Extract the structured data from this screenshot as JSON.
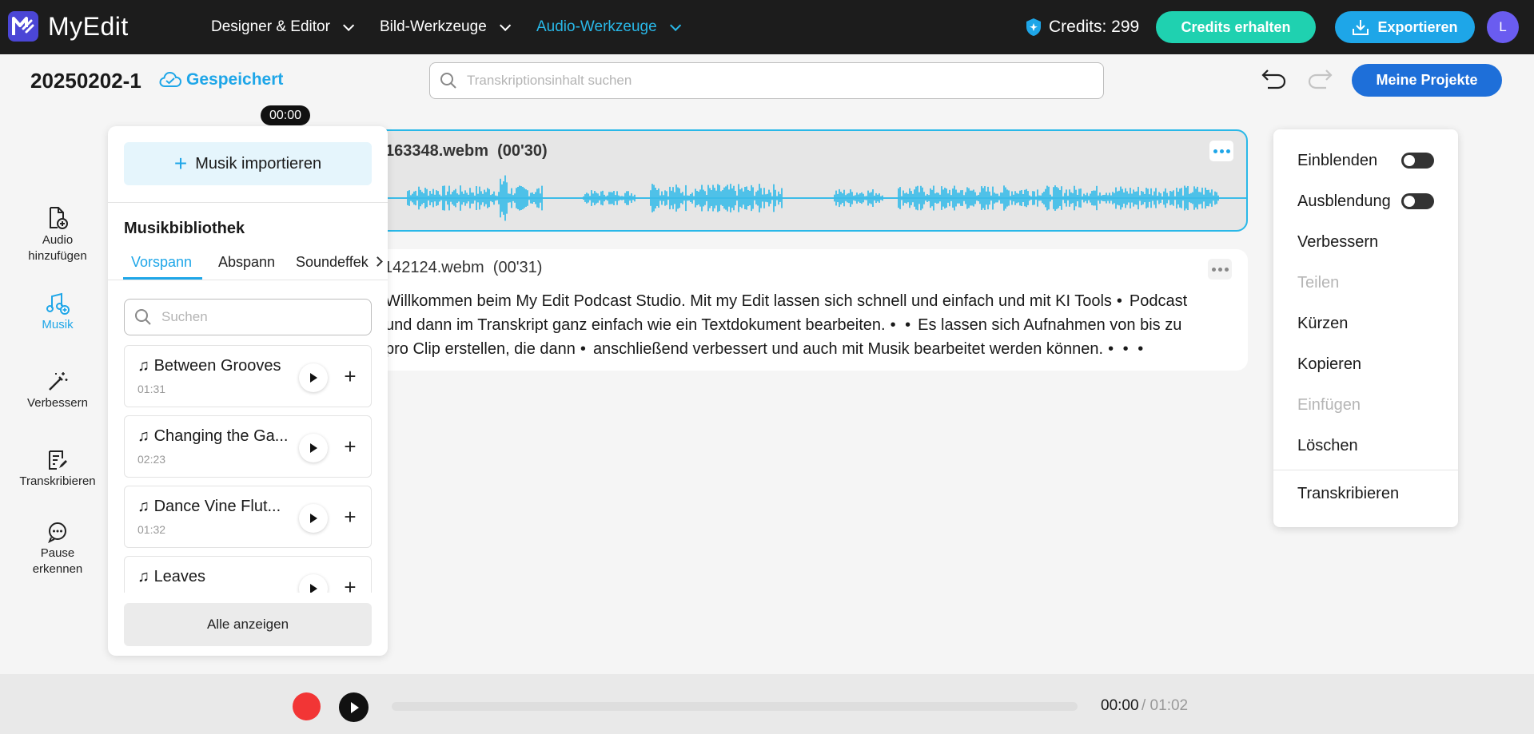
{
  "app": {
    "name": "MyEdit",
    "nav": [
      {
        "label": "Designer & Editor",
        "active": false
      },
      {
        "label": "Bild-Werkzeuge",
        "active": false
      },
      {
        "label": "Audio-Werkzeuge",
        "active": true
      }
    ],
    "credits_label": "Credits: 299",
    "credits_button": "Credits erhalten",
    "export_button": "Exportieren",
    "avatar_initial": "L",
    "accent_color": "#29b8e8"
  },
  "project": {
    "title": "20250202-1",
    "saved_label": "Gespeichert",
    "search_placeholder": "Transkriptionsinhalt suchen",
    "projects_button": "Meine Projekte"
  },
  "playhead_time": "00:00",
  "tools": [
    {
      "label_line1": "Audio",
      "label_line2": "hinzufügen",
      "icon": "add-file-icon",
      "active": false
    },
    {
      "label_line1": "Musik",
      "label_line2": "",
      "icon": "music-add-icon",
      "active": true
    },
    {
      "label_line1": "Verbessern",
      "label_line2": "",
      "icon": "magic-wand-icon",
      "active": false
    },
    {
      "label_line1": "Transkribieren",
      "label_line2": "",
      "icon": "transcribe-icon",
      "active": false
    },
    {
      "label_line1": "Pause",
      "label_line2": "erkennen",
      "icon": "pause-detect-icon",
      "active": false
    }
  ],
  "music_panel": {
    "import_button": "Musik importieren",
    "library_title": "Musikbibliothek",
    "tabs": [
      "Vorspann",
      "Abspann",
      "Soundeffek"
    ],
    "active_tab": "Vorspann",
    "search_placeholder": "Suchen",
    "tracks": [
      {
        "name": "Between Grooves",
        "duration": "01:31"
      },
      {
        "name": "Changing the Ga...",
        "duration": "02:23"
      },
      {
        "name": "Dance Vine Flut...",
        "duration": "01:32"
      },
      {
        "name": "Leaves",
        "duration": ""
      }
    ],
    "show_all_button": "Alle anzeigen"
  },
  "clips": [
    {
      "name": "163348.webm",
      "duration": "(00'30)",
      "selected": true
    },
    {
      "name": "142124.webm",
      "duration": "(00'31)",
      "selected": false,
      "transcript_lines": [
        [
          "Willkommen beim My Edit Podcast Studio. Mit my Edit lassen sich schnell und einfach und mit KI Tools",
          "•",
          "Podcast"
        ],
        [
          "und dann im Transkript ganz einfach wie ein Textdokument bearbeiten.",
          "• •",
          "Es lassen sich Aufnahmen von bis zu"
        ],
        [
          "pro Clip erstellen, die dann",
          "•",
          "anschließend verbessert und auch mit Musik bearbeitet werden können.",
          "• • •"
        ]
      ]
    }
  ],
  "context_menu": {
    "items": [
      {
        "label": "Einblenden",
        "toggle": true,
        "enabled": true
      },
      {
        "label": "Ausblendung",
        "toggle": true,
        "enabled": true
      },
      {
        "label": "Verbessern",
        "enabled": true
      },
      {
        "label": "Teilen",
        "enabled": false
      },
      {
        "label": "Kürzen",
        "enabled": true
      },
      {
        "label": "Kopieren",
        "enabled": true
      },
      {
        "label": "Einfügen",
        "enabled": false
      },
      {
        "label": "Löschen",
        "enabled": true
      }
    ],
    "footer_item": "Transkribieren"
  },
  "player": {
    "current_time": "00:00",
    "total_time": "/ 01:02",
    "progress": 0
  }
}
